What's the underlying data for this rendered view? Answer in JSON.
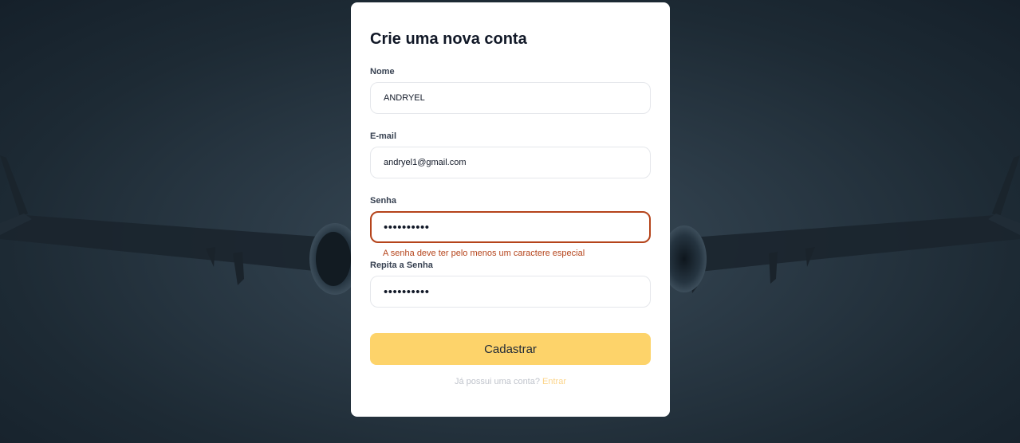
{
  "form": {
    "title": "Crie uma nova conta",
    "name_label": "Nome",
    "name_value": "ANDRYEL",
    "email_label": "E-mail",
    "email_value": "andryel1@gmail.com",
    "password_label": "Senha",
    "password_value": "••••••••••",
    "password_error": "A senha deve ter pelo menos um caractere especial",
    "confirm_label": "Repita a Senha",
    "confirm_value": "••••••••••",
    "submit_label": "Cadastrar",
    "footer_text": "Já possui uma conta?",
    "footer_link": "Entrar"
  },
  "colors": {
    "accent": "#fdd36a",
    "error": "#b5441b",
    "link": "#fcd58b"
  }
}
